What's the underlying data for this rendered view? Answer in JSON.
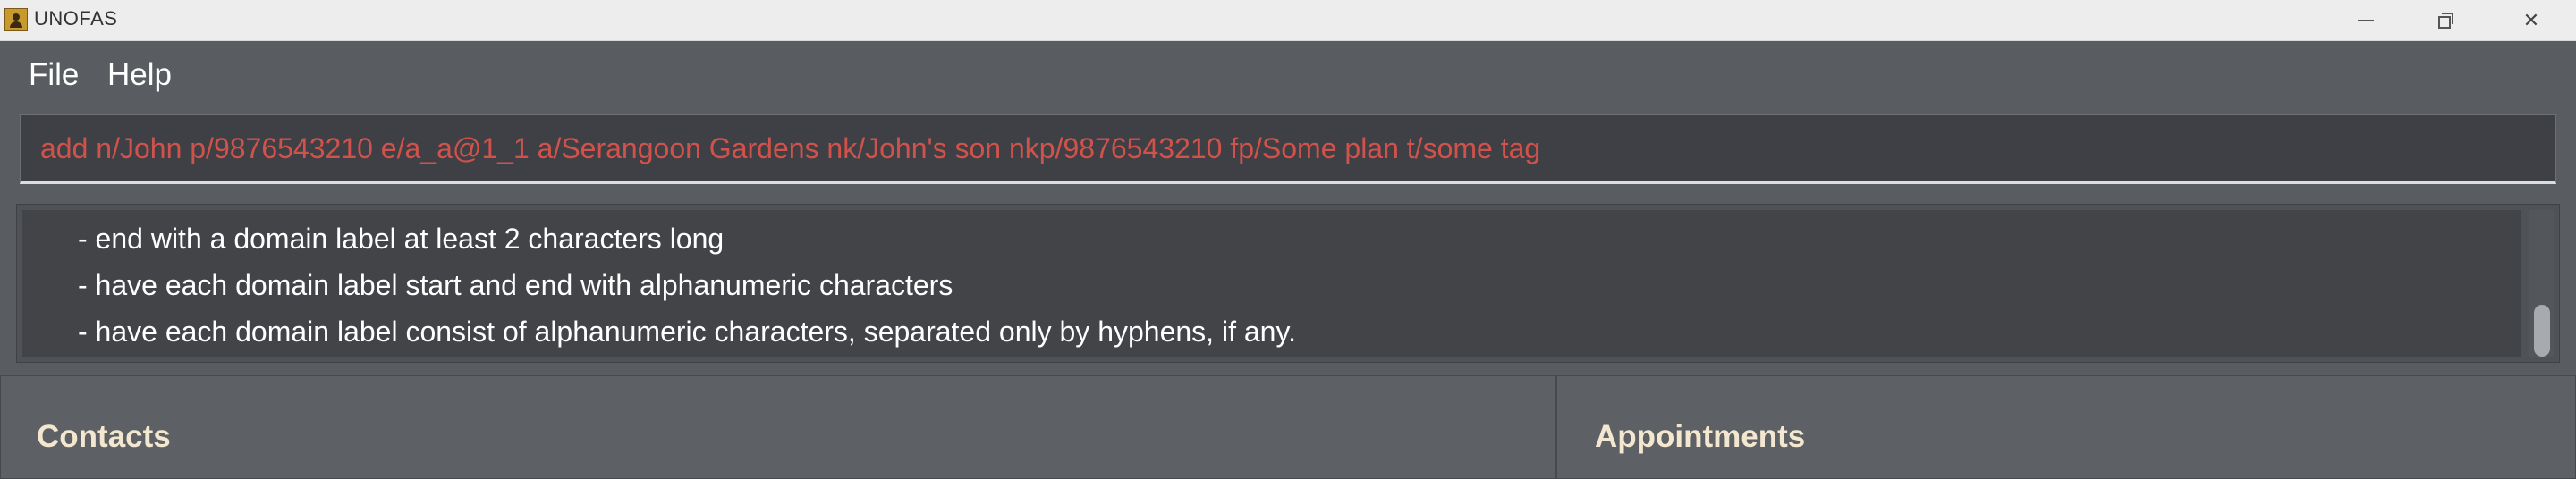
{
  "window": {
    "title": "UNOFAS",
    "app_icon": "contact-card-icon",
    "controls": [
      "minimize-icon",
      "restore-icon",
      "close-icon"
    ],
    "close_glyph": "✕"
  },
  "menu": {
    "items": [
      {
        "label": "File"
      },
      {
        "label": "Help"
      }
    ]
  },
  "command": {
    "value": "add n/John p/9876543210 e/a_a@1_1 a/Serangoon Gardens nk/John's son nkp/9876543210 fp/Some plan t/some tag",
    "text_color": "#d1524b"
  },
  "result": {
    "lines": [
      "- end with a domain label at least 2 characters long",
      "- have each domain label start and end with alphanumeric characters",
      "- have each domain label consist of alphanumeric characters, separated only by hyphens, if any."
    ]
  },
  "panels": {
    "contacts_title": "Contacts",
    "appointments_title": "Appointments",
    "title_color": "#f3e7cf"
  },
  "colors": {
    "background": "#595c60",
    "command_bg": "#3e4045",
    "result_bg": "#424448"
  }
}
